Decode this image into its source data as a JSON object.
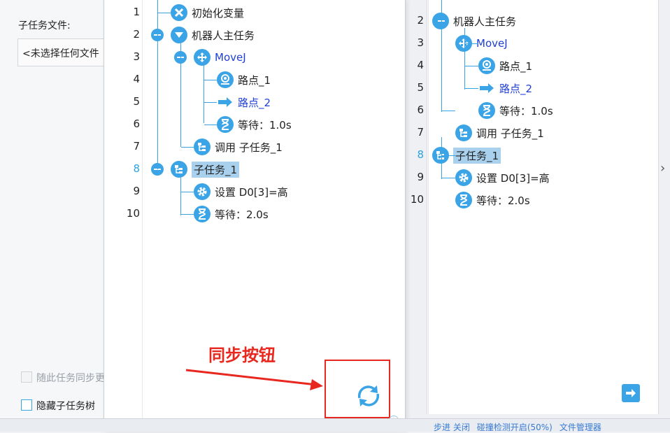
{
  "left": {
    "subtask_file_label": "子任务文件:",
    "subtask_file_value": "<未选择任何文件",
    "sync_checkbox_label": "随此任务同步更",
    "hide_tree_label": "隐藏子任务树"
  },
  "dialog_tree": [
    {
      "line": "1",
      "label": "初始化变量",
      "icon": "x-icon",
      "style": "normal"
    },
    {
      "line": "2",
      "label": "机器人主任务",
      "icon": "chevron-down-icon",
      "style": "normal"
    },
    {
      "line": "3",
      "label": "MoveJ",
      "icon": "move-icon",
      "style": "blue"
    },
    {
      "line": "4",
      "label": "路点_1",
      "icon": "waypoint-icon",
      "style": "normal"
    },
    {
      "line": "5",
      "label": "路点_2",
      "icon": "arrow-right-icon",
      "style": "blue"
    },
    {
      "line": "6",
      "label": "等待：1.0s",
      "icon": "hourglass-icon",
      "style": "normal"
    },
    {
      "line": "7",
      "label": "调用 子任务_1",
      "icon": "subtask-icon",
      "style": "normal"
    },
    {
      "line": "8",
      "label": "子任务_1",
      "icon": "subtask-icon",
      "style": "selected"
    },
    {
      "line": "9",
      "label": "设置 D0[3]=高",
      "icon": "gear-icon",
      "style": "normal"
    },
    {
      "line": "10",
      "label": "等待：2.0s",
      "icon": "hourglass-icon",
      "style": "normal"
    }
  ],
  "right_tree": [
    {
      "line": "2",
      "label": "机器人主任务",
      "icon": "chevron-down-icon",
      "style": "normal"
    },
    {
      "line": "3",
      "label": "MoveJ",
      "icon": "move-icon",
      "style": "blue"
    },
    {
      "line": "4",
      "label": "路点_1",
      "icon": "waypoint-icon",
      "style": "normal"
    },
    {
      "line": "5",
      "label": "路点_2",
      "icon": "arrow-right-icon",
      "style": "blue"
    },
    {
      "line": "6",
      "label": "等待：1.0s",
      "icon": "hourglass-icon",
      "style": "normal"
    },
    {
      "line": "7",
      "label": "调用 子任务_1",
      "icon": "subtask-icon",
      "style": "normal"
    },
    {
      "line": "8",
      "label": "子任务_1",
      "icon": "subtask-icon",
      "style": "selected"
    },
    {
      "line": "9",
      "label": "设置 D0[3]=高",
      "icon": "gear-icon",
      "style": "normal"
    },
    {
      "line": "10",
      "label": "等待：2.0s",
      "icon": "hourglass-icon",
      "style": "normal"
    }
  ],
  "annotation": {
    "text": "同步按钮",
    "color": "#e8281e"
  },
  "status": {
    "step_close": "步进 关闭",
    "collision": "碰撞检测开启(50%)",
    "file_manager": "文件管理器"
  },
  "colors": {
    "accent": "#3aa4e6",
    "selection": "#a9d1ee",
    "blue_text": "#1f3fd6",
    "annotation": "#e8281e"
  }
}
